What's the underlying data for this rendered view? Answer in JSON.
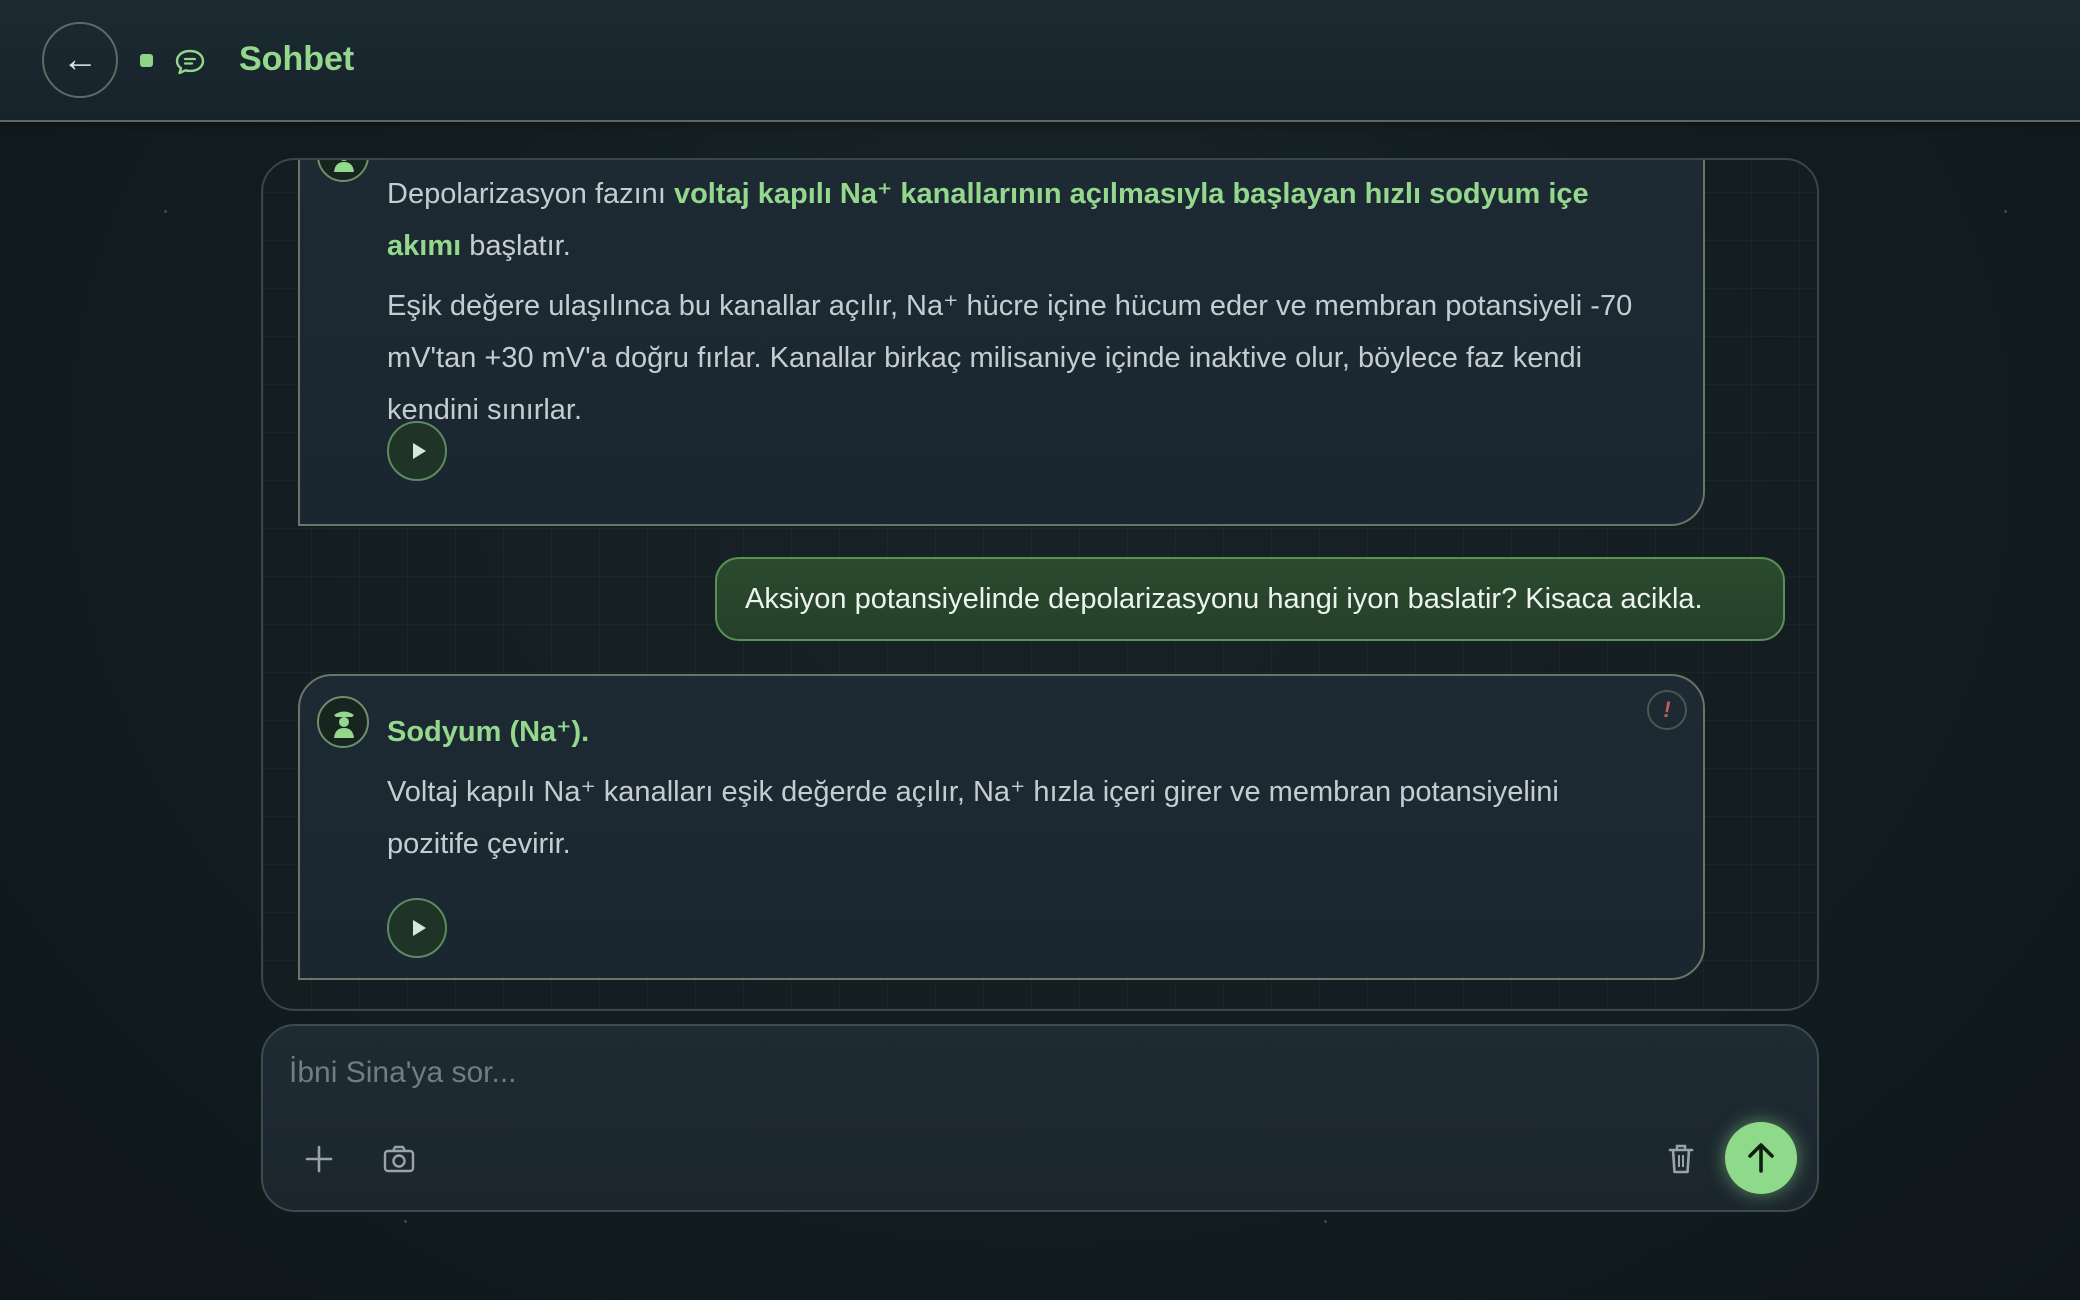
{
  "header": {
    "back_symbol": "←",
    "title": "Sohbet",
    "icons": {
      "back": "arrow-left-icon",
      "status": "status-dot",
      "chat": "chat-bubble-icon"
    },
    "accent_color": "#94d88e"
  },
  "messages": [
    {
      "role": "assistant",
      "intro_pre": "Depolarizasyon fazını ",
      "intro_bold": "voltaj kapılı Na⁺ kanallarının açılmasıyla başlayan hızlı sodyum içe akımı",
      "intro_post": " başlatır.",
      "paragraph": "Eşik değere ulaşılınca bu kanallar açılır, Na⁺ hücre içine hücum eder ve membran potansiyeli -70 mV'tan +30 mV'a doğru fırlar. Kanallar birkaç milisaniye içinde inaktive olur, böylece faz kendi kendini sınırlar.",
      "play_icon": "play-icon"
    },
    {
      "role": "user",
      "text": "Aksiyon potansiyelinde depolarizasyonu hangi iyon baslatir? Kisaca acikla."
    },
    {
      "role": "assistant",
      "title": "Sodyum (Na⁺).",
      "paragraph": "Voltaj kapılı Na⁺ kanalları eşik değerde açılır, Na⁺ hızla içeri girer ve membran potansiyelini pozitife çevirir.",
      "warning_symbol": "!",
      "play_icon": "play-icon"
    }
  ],
  "composer": {
    "placeholder": "İbni Sina'ya sor...",
    "icons": {
      "add": "plus-icon",
      "camera": "camera-icon",
      "delete": "trash-icon",
      "send": "arrow-up-icon"
    }
  }
}
